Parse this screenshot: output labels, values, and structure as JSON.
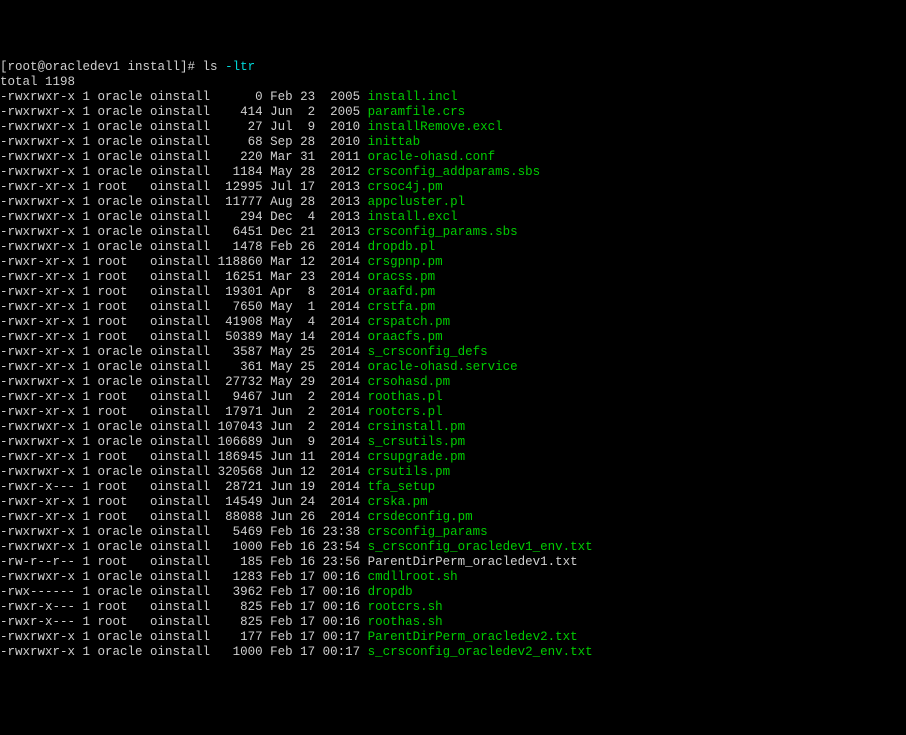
{
  "prompt": {
    "prefix": "[root@oracledev1 install]# ",
    "cmd": "ls ",
    "flags": "-ltr"
  },
  "total_line": "total 1198",
  "rows": [
    {
      "perm": "-rwxrwxr-x",
      "lnk": "1",
      "owner": "oracle",
      "group": "oinstall",
      "size": "0",
      "date": "Feb 23  2005",
      "name": "install.incl",
      "c": "green"
    },
    {
      "perm": "-rwxrwxr-x",
      "lnk": "1",
      "owner": "oracle",
      "group": "oinstall",
      "size": "414",
      "date": "Jun  2  2005",
      "name": "paramfile.crs",
      "c": "green"
    },
    {
      "perm": "-rwxrwxr-x",
      "lnk": "1",
      "owner": "oracle",
      "group": "oinstall",
      "size": "27",
      "date": "Jul  9  2010",
      "name": "installRemove.excl",
      "c": "green"
    },
    {
      "perm": "-rwxrwxr-x",
      "lnk": "1",
      "owner": "oracle",
      "group": "oinstall",
      "size": "68",
      "date": "Sep 28  2010",
      "name": "inittab",
      "c": "green"
    },
    {
      "perm": "-rwxrwxr-x",
      "lnk": "1",
      "owner": "oracle",
      "group": "oinstall",
      "size": "220",
      "date": "Mar 31  2011",
      "name": "oracle-ohasd.conf",
      "c": "green"
    },
    {
      "perm": "-rwxrwxr-x",
      "lnk": "1",
      "owner": "oracle",
      "group": "oinstall",
      "size": "1184",
      "date": "May 28  2012",
      "name": "crsconfig_addparams.sbs",
      "c": "green"
    },
    {
      "perm": "-rwxr-xr-x",
      "lnk": "1",
      "owner": "root",
      "group": "oinstall",
      "size": "12995",
      "date": "Jul 17  2013",
      "name": "crsoc4j.pm",
      "c": "green"
    },
    {
      "perm": "-rwxrwxr-x",
      "lnk": "1",
      "owner": "oracle",
      "group": "oinstall",
      "size": "11777",
      "date": "Aug 28  2013",
      "name": "appcluster.pl",
      "c": "green"
    },
    {
      "perm": "-rwxrwxr-x",
      "lnk": "1",
      "owner": "oracle",
      "group": "oinstall",
      "size": "294",
      "date": "Dec  4  2013",
      "name": "install.excl",
      "c": "green"
    },
    {
      "perm": "-rwxrwxr-x",
      "lnk": "1",
      "owner": "oracle",
      "group": "oinstall",
      "size": "6451",
      "date": "Dec 21  2013",
      "name": "crsconfig_params.sbs",
      "c": "green"
    },
    {
      "perm": "-rwxrwxr-x",
      "lnk": "1",
      "owner": "oracle",
      "group": "oinstall",
      "size": "1478",
      "date": "Feb 26  2014",
      "name": "dropdb.pl",
      "c": "green"
    },
    {
      "perm": "-rwxr-xr-x",
      "lnk": "1",
      "owner": "root",
      "group": "oinstall",
      "size": "118860",
      "date": "Mar 12  2014",
      "name": "crsgpnp.pm",
      "c": "green"
    },
    {
      "perm": "-rwxr-xr-x",
      "lnk": "1",
      "owner": "root",
      "group": "oinstall",
      "size": "16251",
      "date": "Mar 23  2014",
      "name": "oracss.pm",
      "c": "green"
    },
    {
      "perm": "-rwxr-xr-x",
      "lnk": "1",
      "owner": "root",
      "group": "oinstall",
      "size": "19301",
      "date": "Apr  8  2014",
      "name": "oraafd.pm",
      "c": "green"
    },
    {
      "perm": "-rwxr-xr-x",
      "lnk": "1",
      "owner": "root",
      "group": "oinstall",
      "size": "7650",
      "date": "May  1  2014",
      "name": "crstfa.pm",
      "c": "green"
    },
    {
      "perm": "-rwxr-xr-x",
      "lnk": "1",
      "owner": "root",
      "group": "oinstall",
      "size": "41908",
      "date": "May  4  2014",
      "name": "crspatch.pm",
      "c": "green"
    },
    {
      "perm": "-rwxr-xr-x",
      "lnk": "1",
      "owner": "root",
      "group": "oinstall",
      "size": "50389",
      "date": "May 14  2014",
      "name": "oraacfs.pm",
      "c": "green"
    },
    {
      "perm": "-rwxr-xr-x",
      "lnk": "1",
      "owner": "oracle",
      "group": "oinstall",
      "size": "3587",
      "date": "May 25  2014",
      "name": "s_crsconfig_defs",
      "c": "green"
    },
    {
      "perm": "-rwxr-xr-x",
      "lnk": "1",
      "owner": "oracle",
      "group": "oinstall",
      "size": "361",
      "date": "May 25  2014",
      "name": "oracle-ohasd.service",
      "c": "green"
    },
    {
      "perm": "-rwxrwxr-x",
      "lnk": "1",
      "owner": "oracle",
      "group": "oinstall",
      "size": "27732",
      "date": "May 29  2014",
      "name": "crsohasd.pm",
      "c": "green"
    },
    {
      "perm": "-rwxr-xr-x",
      "lnk": "1",
      "owner": "root",
      "group": "oinstall",
      "size": "9467",
      "date": "Jun  2  2014",
      "name": "roothas.pl",
      "c": "green"
    },
    {
      "perm": "-rwxr-xr-x",
      "lnk": "1",
      "owner": "root",
      "group": "oinstall",
      "size": "17971",
      "date": "Jun  2  2014",
      "name": "rootcrs.pl",
      "c": "green"
    },
    {
      "perm": "-rwxrwxr-x",
      "lnk": "1",
      "owner": "oracle",
      "group": "oinstall",
      "size": "107043",
      "date": "Jun  2  2014",
      "name": "crsinstall.pm",
      "c": "green"
    },
    {
      "perm": "-rwxrwxr-x",
      "lnk": "1",
      "owner": "oracle",
      "group": "oinstall",
      "size": "106689",
      "date": "Jun  9  2014",
      "name": "s_crsutils.pm",
      "c": "green"
    },
    {
      "perm": "-rwxr-xr-x",
      "lnk": "1",
      "owner": "root",
      "group": "oinstall",
      "size": "186945",
      "date": "Jun 11  2014",
      "name": "crsupgrade.pm",
      "c": "green"
    },
    {
      "perm": "-rwxrwxr-x",
      "lnk": "1",
      "owner": "oracle",
      "group": "oinstall",
      "size": "320568",
      "date": "Jun 12  2014",
      "name": "crsutils.pm",
      "c": "green"
    },
    {
      "perm": "-rwxr-x---",
      "lnk": "1",
      "owner": "root",
      "group": "oinstall",
      "size": "28721",
      "date": "Jun 19  2014",
      "name": "tfa_setup",
      "c": "green"
    },
    {
      "perm": "-rwxr-xr-x",
      "lnk": "1",
      "owner": "root",
      "group": "oinstall",
      "size": "14549",
      "date": "Jun 24  2014",
      "name": "crska.pm",
      "c": "green"
    },
    {
      "perm": "-rwxr-xr-x",
      "lnk": "1",
      "owner": "root",
      "group": "oinstall",
      "size": "88088",
      "date": "Jun 26  2014",
      "name": "crsdeconfig.pm",
      "c": "green"
    },
    {
      "perm": "-rwxrwxr-x",
      "lnk": "1",
      "owner": "oracle",
      "group": "oinstall",
      "size": "5469",
      "date": "Feb 16 23:38",
      "name": "crsconfig_params",
      "c": "green"
    },
    {
      "perm": "-rwxrwxr-x",
      "lnk": "1",
      "owner": "oracle",
      "group": "oinstall",
      "size": "1000",
      "date": "Feb 16 23:54",
      "name": "s_crsconfig_oracledev1_env.txt",
      "c": "green"
    },
    {
      "perm": "-rw-r--r--",
      "lnk": "1",
      "owner": "root",
      "group": "oinstall",
      "size": "185",
      "date": "Feb 16 23:56",
      "name": "ParentDirPerm_oracledev1.txt",
      "c": "white"
    },
    {
      "perm": "-rwxrwxr-x",
      "lnk": "1",
      "owner": "oracle",
      "group": "oinstall",
      "size": "1283",
      "date": "Feb 17 00:16",
      "name": "cmdllroot.sh",
      "c": "green"
    },
    {
      "perm": "-rwx------",
      "lnk": "1",
      "owner": "oracle",
      "group": "oinstall",
      "size": "3962",
      "date": "Feb 17 00:16",
      "name": "dropdb",
      "c": "green"
    },
    {
      "perm": "-rwxr-x---",
      "lnk": "1",
      "owner": "root",
      "group": "oinstall",
      "size": "825",
      "date": "Feb 17 00:16",
      "name": "rootcrs.sh",
      "c": "green"
    },
    {
      "perm": "-rwxr-x---",
      "lnk": "1",
      "owner": "root",
      "group": "oinstall",
      "size": "825",
      "date": "Feb 17 00:16",
      "name": "roothas.sh",
      "c": "green"
    },
    {
      "perm": "-rwxrwxr-x",
      "lnk": "1",
      "owner": "oracle",
      "group": "oinstall",
      "size": "177",
      "date": "Feb 17 00:17",
      "name": "ParentDirPerm_oracledev2.txt",
      "c": "green"
    },
    {
      "perm": "-rwxrwxr-x",
      "lnk": "1",
      "owner": "oracle",
      "group": "oinstall",
      "size": "1000",
      "date": "Feb 17 00:17",
      "name": "s_crsconfig_oracledev2_env.txt",
      "c": "green"
    }
  ]
}
